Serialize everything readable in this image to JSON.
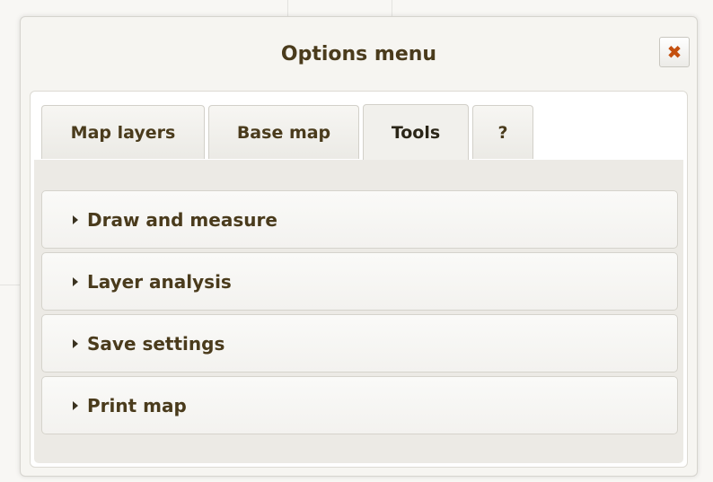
{
  "dialog": {
    "title": "Options menu",
    "close_icon": "close-icon",
    "close_color": "#c4500f"
  },
  "tabs": [
    {
      "label": "Map layers",
      "active": false
    },
    {
      "label": "Base map",
      "active": false
    },
    {
      "label": "Tools",
      "active": true
    },
    {
      "label": "?",
      "active": false
    }
  ],
  "tools": {
    "items": [
      {
        "label": "Draw and measure",
        "icon": "caret-right-icon",
        "expanded": false
      },
      {
        "label": "Layer analysis",
        "icon": "caret-right-icon",
        "expanded": false
      },
      {
        "label": "Save settings",
        "icon": "caret-right-icon",
        "expanded": false
      },
      {
        "label": "Print map",
        "icon": "caret-right-icon",
        "expanded": false
      }
    ]
  },
  "colors": {
    "text": "#4a3b1c",
    "accent": "#c4500f"
  }
}
